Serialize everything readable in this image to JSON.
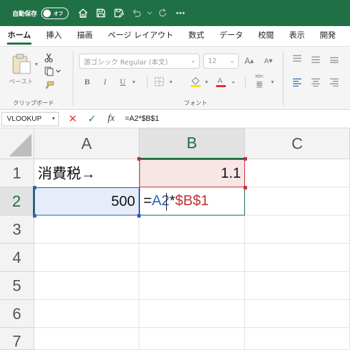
{
  "titlebar": {
    "autosave_label": "自動保存",
    "autosave_state": "オフ",
    "icons": [
      "home-icon",
      "save-icon",
      "save-as-icon",
      "undo-icon",
      "chevron-down-icon",
      "redo-icon",
      "more-icon"
    ],
    "background": "#1f7145"
  },
  "tabs": [
    "ホーム",
    "挿入",
    "描画",
    "ページ レイアウト",
    "数式",
    "データ",
    "校閲",
    "表示",
    "開発"
  ],
  "active_tab": "ホーム",
  "ribbon": {
    "clipboard": {
      "paste_label": "ペースト",
      "group_label": "クリップボード"
    },
    "font": {
      "font_name": "游ゴシック Regular (本文)",
      "font_size": "12",
      "bold": "B",
      "italic": "I",
      "underline": "U",
      "strike_label": "abc",
      "group_label": "フォント"
    }
  },
  "formula_bar": {
    "name_box": "VLOOKUP",
    "cancel_symbol": "✕",
    "enter_symbol": "✓",
    "fx_label": "fx",
    "formula": "=A2*$B$1"
  },
  "sheet": {
    "columns": [
      "A",
      "B",
      "C"
    ],
    "rows": [
      "1",
      "2",
      "3",
      "4",
      "5",
      "6",
      "7"
    ],
    "cells": {
      "A1": "消費税→",
      "B1": "1.1",
      "A2": "500"
    },
    "editing_cell": "B2",
    "editing_formula": {
      "eq": "=",
      "ref_a": "A2",
      "op": "*",
      "ref_b": "$B$1"
    },
    "colors": {
      "accent": "#1e6e41",
      "ref_a_color": "#2c62b8",
      "ref_b_color": "#c0303a",
      "ref_a_fill": "#e6edf8",
      "ref_b_fill": "#f8e5e5"
    }
  }
}
